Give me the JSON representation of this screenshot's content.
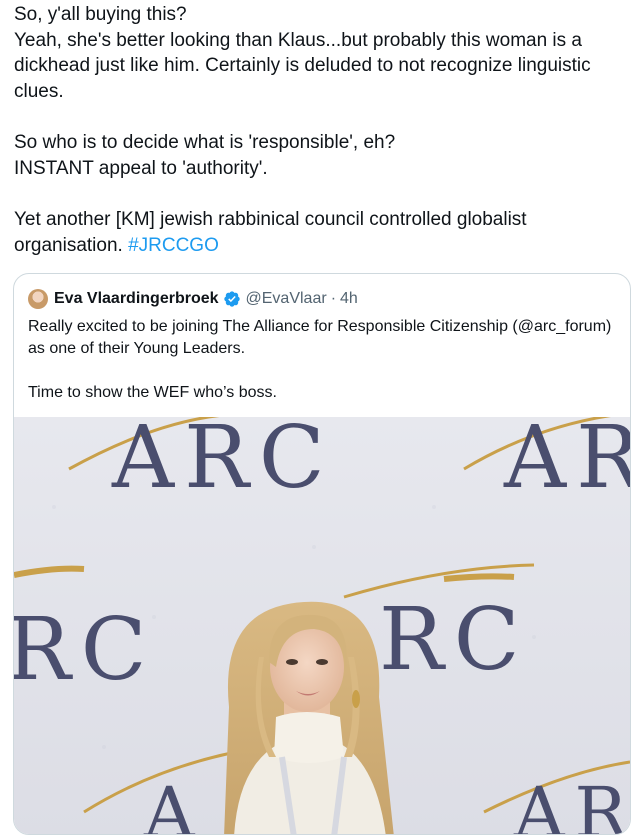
{
  "post": {
    "lines": [
      "So, y'all buying this?",
      "Yeah, she's better looking than Klaus...but probably this woman is a dickhead just like him.  Certainly is deluded to not recognize linguistic clues.",
      "So who is to decide what is 'responsible', eh?",
      "INSTANT appeal to 'authority'.",
      "Yet another [KM] jewish rabbinical council controlled globalist organisation."
    ],
    "hashtag": "#JRCCGO"
  },
  "quote": {
    "author_name": "Eva Vlaardingerbroek",
    "handle": "@EvaVlaar",
    "separator": "·",
    "time": "4h",
    "verified": true,
    "text_line1": "Really excited to be joining The Alliance for Responsible Citizenship (@arc_forum) as one of their Young Leaders.",
    "text_line2": "Time to show the WEF who’s boss.",
    "photo_banner_texts": [
      "ARC",
      "AR",
      "RC",
      "RC",
      "AR",
      "A"
    ]
  },
  "icons": {
    "verified": "verified-badge-icon",
    "avatar": "avatar"
  },
  "colors": {
    "text": "#0f1419",
    "secondary": "#536471",
    "link": "#1d9bf0",
    "border": "#cfd9de",
    "banner_text": "#4a4e6e",
    "banner_swoosh": "#c9a04a"
  }
}
